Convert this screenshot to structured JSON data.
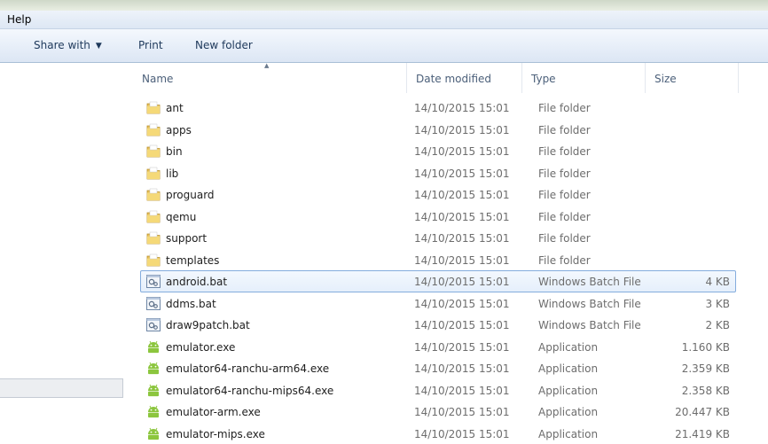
{
  "menu": {
    "help": "Help"
  },
  "toolbar": {
    "share_with": "Share with",
    "print": "Print",
    "new_folder": "New folder"
  },
  "columns": {
    "name": "Name",
    "date": "Date modified",
    "type": "Type",
    "size": "Size"
  },
  "files": [
    {
      "name": "ant",
      "date": "14/10/2015 15:01",
      "type": "File folder",
      "size": "",
      "icon": "folder-icon"
    },
    {
      "name": "apps",
      "date": "14/10/2015 15:01",
      "type": "File folder",
      "size": "",
      "icon": "folder-icon"
    },
    {
      "name": "bin",
      "date": "14/10/2015 15:01",
      "type": "File folder",
      "size": "",
      "icon": "folder-icon"
    },
    {
      "name": "lib",
      "date": "14/10/2015 15:01",
      "type": "File folder",
      "size": "",
      "icon": "folder-icon"
    },
    {
      "name": "proguard",
      "date": "14/10/2015 15:01",
      "type": "File folder",
      "size": "",
      "icon": "folder-icon"
    },
    {
      "name": "qemu",
      "date": "14/10/2015 15:01",
      "type": "File folder",
      "size": "",
      "icon": "folder-icon"
    },
    {
      "name": "support",
      "date": "14/10/2015 15:01",
      "type": "File folder",
      "size": "",
      "icon": "folder-icon"
    },
    {
      "name": "templates",
      "date": "14/10/2015 15:01",
      "type": "File folder",
      "size": "",
      "icon": "folder-icon"
    },
    {
      "name": "android.bat",
      "date": "14/10/2015 15:01",
      "type": "Windows Batch File",
      "size": "4 KB",
      "icon": "batch-file-icon",
      "selected": true
    },
    {
      "name": "ddms.bat",
      "date": "14/10/2015 15:01",
      "type": "Windows Batch File",
      "size": "3 KB",
      "icon": "batch-file-icon"
    },
    {
      "name": "draw9patch.bat",
      "date": "14/10/2015 15:01",
      "type": "Windows Batch File",
      "size": "2 KB",
      "icon": "batch-file-icon"
    },
    {
      "name": "emulator.exe",
      "date": "14/10/2015 15:01",
      "type": "Application",
      "size": "1.160 KB",
      "icon": "android-app-icon"
    },
    {
      "name": "emulator64-ranchu-arm64.exe",
      "date": "14/10/2015 15:01",
      "type": "Application",
      "size": "2.359 KB",
      "icon": "android-app-icon"
    },
    {
      "name": "emulator64-ranchu-mips64.exe",
      "date": "14/10/2015 15:01",
      "type": "Application",
      "size": "2.358 KB",
      "icon": "android-app-icon"
    },
    {
      "name": "emulator-arm.exe",
      "date": "14/10/2015 15:01",
      "type": "Application",
      "size": "20.447 KB",
      "icon": "android-app-icon"
    },
    {
      "name": "emulator-mips.exe",
      "date": "14/10/2015 15:01",
      "type": "Application",
      "size": "21.419 KB",
      "icon": "android-app-icon"
    }
  ]
}
